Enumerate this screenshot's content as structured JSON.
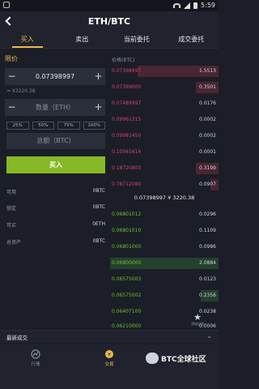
{
  "status": {
    "time": "5:59"
  },
  "header": {
    "title": "ETH/BTC"
  },
  "tabs": [
    {
      "label": "买入"
    },
    {
      "label": "卖出"
    },
    {
      "label": "当前委托"
    },
    {
      "label": "成交委托"
    }
  ],
  "form": {
    "order_type": "限价",
    "price_value": "0.07398997",
    "minus_label": "−",
    "plus_label": "+",
    "cny_value": "≈ ¥3220.38",
    "qty_placeholder": "数量（ETH）",
    "percents": [
      "25%",
      "50%",
      "75%",
      "100%"
    ],
    "total_placeholder": "总额（BTC）",
    "buy_label": "买入"
  },
  "balances": [
    {
      "label": "可用",
      "value": "0BTC"
    },
    {
      "label": "锁定",
      "value": "0BTC"
    },
    {
      "label": "可买",
      "value": "0ETH"
    },
    {
      "label": "总资产",
      "value": "0BTC"
    }
  ],
  "orderbook": {
    "header": "价格(BTC)",
    "asks": [
      {
        "price": "0.07398997",
        "qty": "1.5513"
      },
      {
        "price": "0.07399000",
        "qty": "0.3501"
      },
      {
        "price": "0.07489997",
        "qty": "0.0176"
      },
      {
        "price": "0.09961315",
        "qty": "0.0002"
      },
      {
        "price": "0.09981450",
        "qty": "0.0002"
      },
      {
        "price": "0.10561616",
        "qty": "0.0001"
      },
      {
        "price": "0.18720800",
        "qty": "0.3199"
      },
      {
        "price": "0.78712080",
        "qty": "0.0907"
      }
    ],
    "mid_price": "0.07398997 ¥ 3220.38",
    "bids": [
      {
        "price": "0.06801012",
        "qty": "0.0296"
      },
      {
        "price": "0.06801010",
        "qty": "0.1109"
      },
      {
        "price": "0.06801000",
        "qty": "0.0986"
      },
      {
        "price": "0.06800000",
        "qty": "2.0884"
      },
      {
        "price": "0.06575003",
        "qty": "0.0123"
      },
      {
        "price": "0.06575002",
        "qty": "0.2356"
      },
      {
        "price": "0.06407100",
        "qty": "0.0238"
      },
      {
        "price": "0.06210000",
        "qty": "0.0006"
      }
    ]
  },
  "fab": {
    "label": "添加自选"
  },
  "latest": {
    "title": "最新成交"
  },
  "bottom_nav": [
    {
      "label": "行情"
    },
    {
      "label": "交易"
    }
  ],
  "watermark": {
    "text": "BTC全球社区"
  }
}
